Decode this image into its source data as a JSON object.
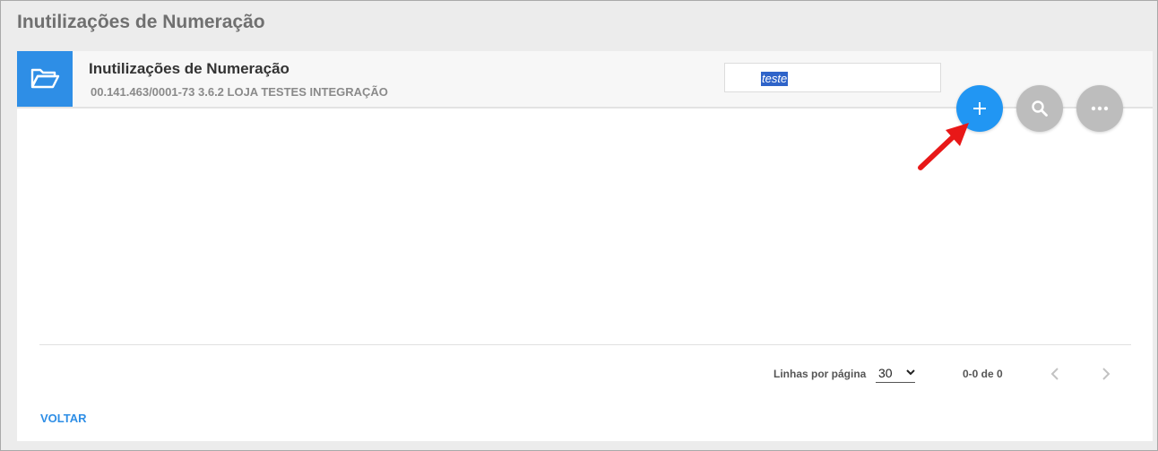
{
  "page": {
    "title": "Inutilizações de Numeração"
  },
  "header": {
    "icon": "folder-open-icon",
    "title": "Inutilizações de Numeração",
    "subtitle": "00.141.463/0001-73 3.6.2 LOJA TESTES INTEGRAÇÃO",
    "accent_color": "#2e8ee6"
  },
  "search": {
    "value": "teste",
    "selected_text": "teste"
  },
  "actions": {
    "add": {
      "icon": "plus-icon",
      "color": "#2196f3"
    },
    "search": {
      "icon": "search-icon",
      "color": "#bdbdbd"
    },
    "more": {
      "icon": "more-horizontal-icon",
      "color": "#bdbdbd"
    }
  },
  "annotation": {
    "icon": "red-arrow-icon",
    "color": "#e81818"
  },
  "pagination": {
    "rows_label": "Linhas por página",
    "rows_value": "30",
    "range": "0-0 de 0",
    "prev_icon": "chevron-left-icon",
    "next_icon": "chevron-right-icon"
  },
  "footer": {
    "back_label": "VOLTAR"
  }
}
